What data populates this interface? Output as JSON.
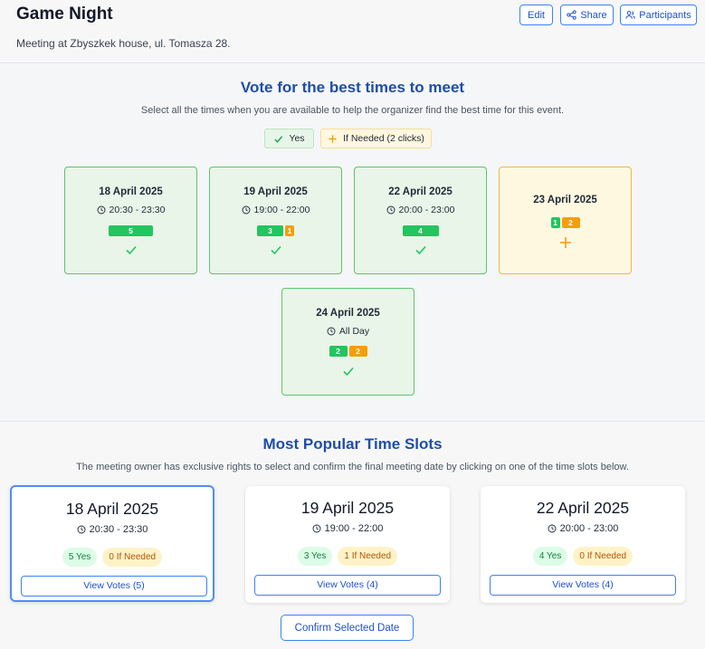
{
  "header": {
    "title": "Game Night",
    "subtitle": "Meeting at Zbyszkek house, ul. Tomasza 28.",
    "buttons": {
      "edit": "Edit",
      "share": "Share",
      "participants": "Participants"
    }
  },
  "vote": {
    "heading": "Vote for the best times to meet",
    "description": "Select all the times when you are available to help the organizer find the best time for this event.",
    "legend": {
      "yes": "Yes",
      "if_needed": "If Needed (2 clicks)"
    },
    "slots": [
      {
        "date": "18 April 2025",
        "time": "20:30 - 23:30",
        "yes": "5",
        "if_needed": "",
        "status": "yes"
      },
      {
        "date": "19 April 2025",
        "time": "19:00 - 22:00",
        "yes": "3",
        "if_needed": "1",
        "status": "yes"
      },
      {
        "date": "22 April 2025",
        "time": "20:00 - 23:00",
        "yes": "4",
        "if_needed": "",
        "status": "yes"
      },
      {
        "date": "23 April 2025",
        "time": "",
        "yes": "1",
        "if_needed": "2",
        "status": "if_needed"
      },
      {
        "date": "24 April 2025",
        "time": "All Day",
        "yes": "2",
        "if_needed": "2",
        "status": "yes"
      }
    ]
  },
  "popular": {
    "heading": "Most Popular Time Slots",
    "description": "The meeting owner has exclusive rights to select and confirm the final meeting date by clicking on one of the time slots below.",
    "slots": [
      {
        "date": "18 April 2025",
        "time": "20:30 - 23:30",
        "yes": "5 Yes",
        "if_needed": "0 If Needed",
        "view": "View Votes (5)"
      },
      {
        "date": "19 April 2025",
        "time": "19:00 - 22:00",
        "yes": "3 Yes",
        "if_needed": "1 If Needed",
        "view": "View Votes (4)"
      },
      {
        "date": "22 April 2025",
        "time": "20:00 - 23:00",
        "yes": "4 Yes",
        "if_needed": "0 If Needed",
        "view": "View Votes (4)"
      }
    ],
    "confirm": "Confirm Selected Date"
  },
  "colors": {
    "accent": "#1e4ea8",
    "button": "#1d4ed8",
    "yes": "#22c55e",
    "if_needed": "#f59e0b"
  },
  "icons": [
    "pencil-icon",
    "share-icon",
    "users-icon",
    "check-icon",
    "plus-icon",
    "clock-icon"
  ]
}
